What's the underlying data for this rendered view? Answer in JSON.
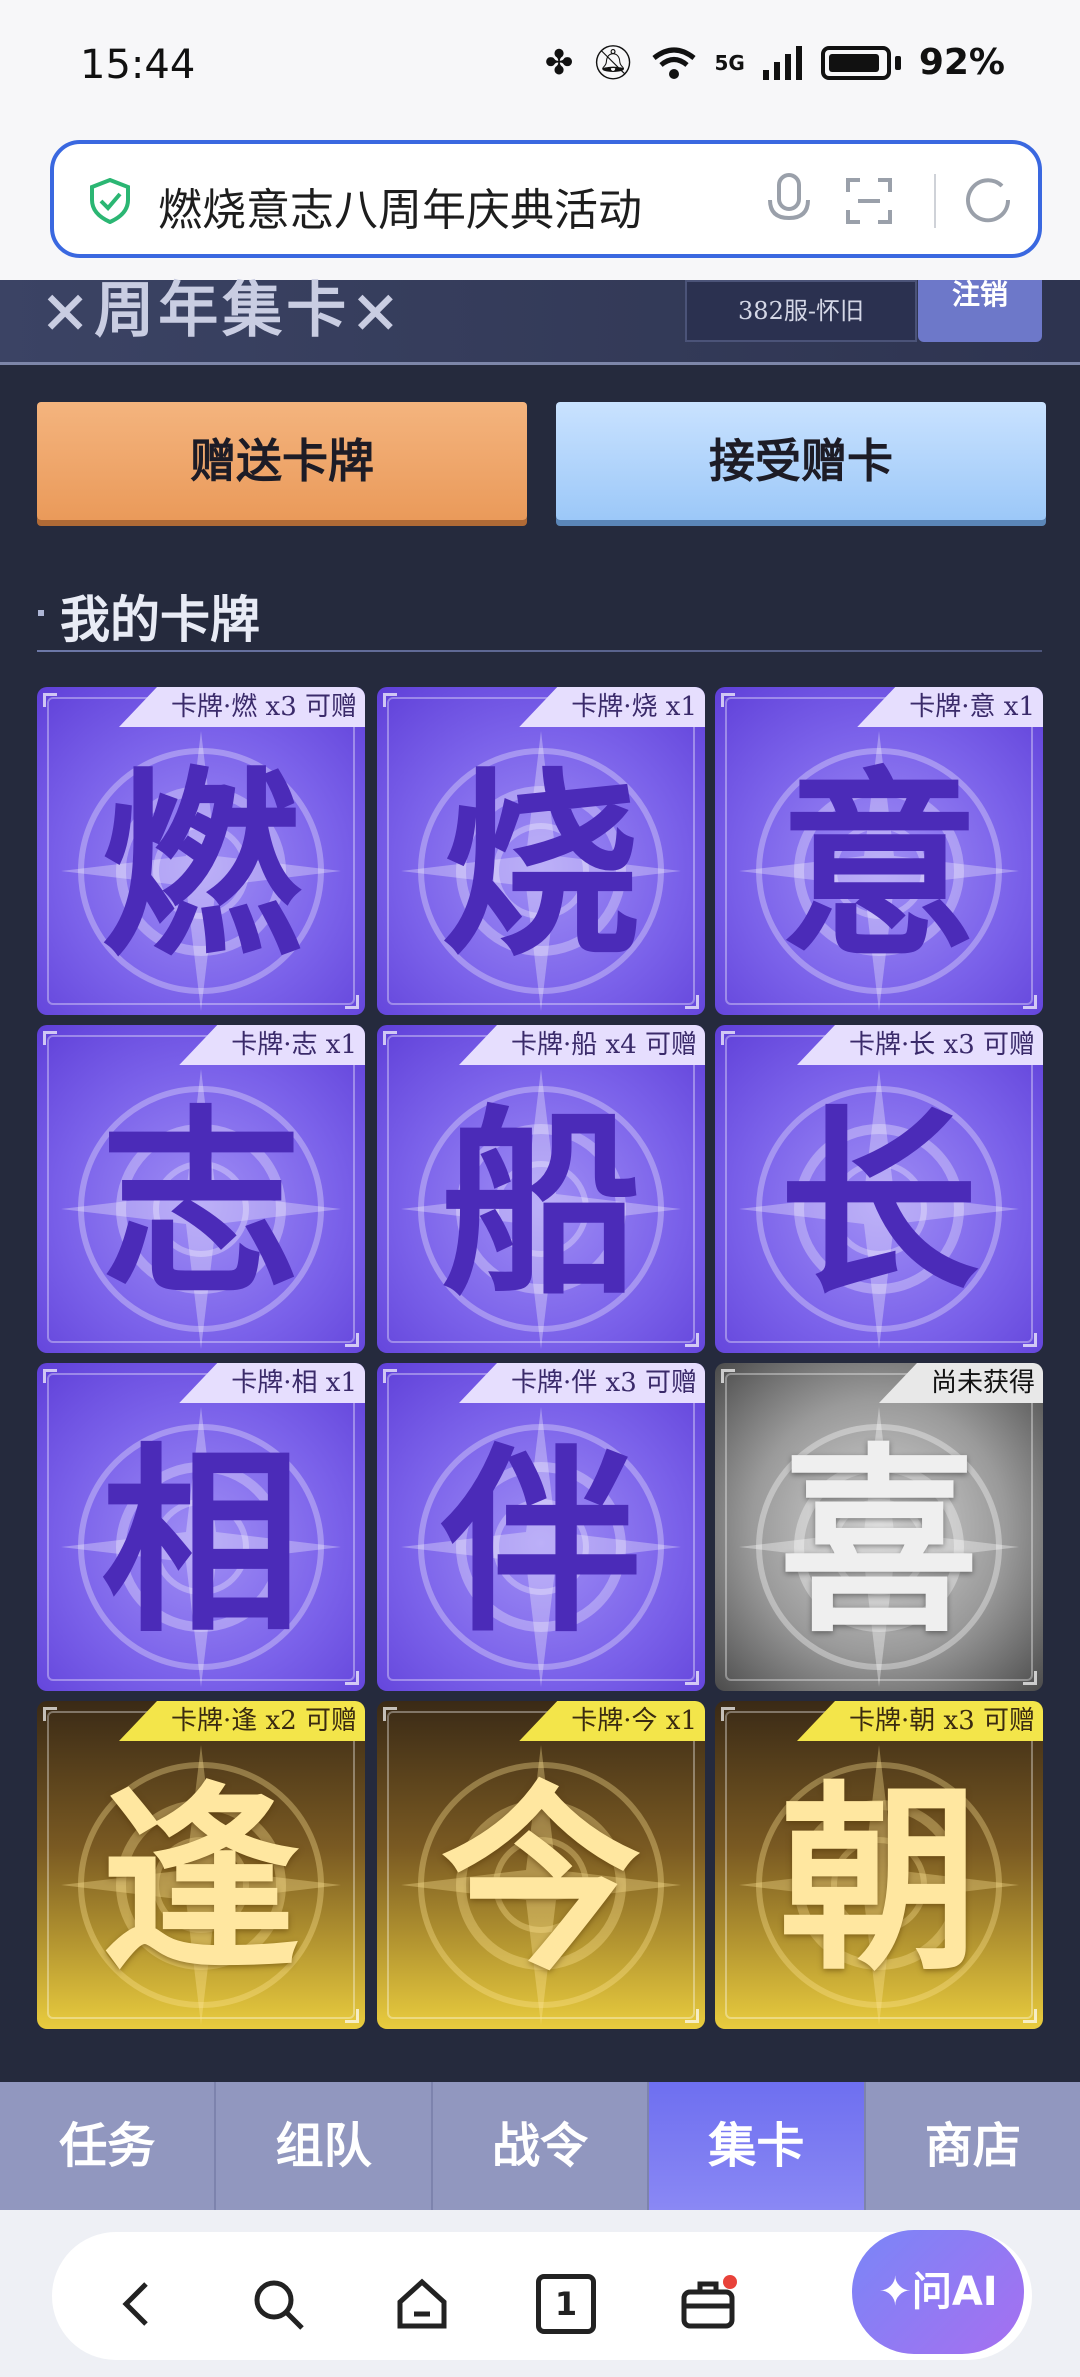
{
  "status_bar": {
    "time": "15:44",
    "network": "5G",
    "battery": "92%"
  },
  "browser": {
    "url_title": "燃烧意志八周年庆典活动"
  },
  "game_header": {
    "title": "×周年集卡×",
    "server": "382服-怀旧",
    "logout_label": "注销"
  },
  "actions": {
    "send_label": "赠送卡牌",
    "receive_label": "接受赠卡"
  },
  "section": {
    "title": "我的卡牌"
  },
  "cards": [
    {
      "char": "燃",
      "tag": "卡牌·燃 x3 可赠",
      "style": "purple"
    },
    {
      "char": "烧",
      "tag": "卡牌·烧 x1",
      "style": "purple"
    },
    {
      "char": "意",
      "tag": "卡牌·意 x1",
      "style": "purple"
    },
    {
      "char": "志",
      "tag": "卡牌·志 x1",
      "style": "purple"
    },
    {
      "char": "船",
      "tag": "卡牌·船 x4 可赠",
      "style": "purple"
    },
    {
      "char": "长",
      "tag": "卡牌·长 x3 可赠",
      "style": "purple"
    },
    {
      "char": "相",
      "tag": "卡牌·相 x1",
      "style": "purple"
    },
    {
      "char": "伴",
      "tag": "卡牌·伴 x3 可赠",
      "style": "purple"
    },
    {
      "char": "喜",
      "tag": "尚未获得",
      "style": "gray"
    },
    {
      "char": "逢",
      "tag": "卡牌·逢 x2 可赠",
      "style": "gold"
    },
    {
      "char": "今",
      "tag": "卡牌·今 x1",
      "style": "gold"
    },
    {
      "char": "朝",
      "tag": "卡牌·朝 x3 可赠",
      "style": "gold"
    }
  ],
  "tabs": [
    {
      "label": "任务",
      "active": false
    },
    {
      "label": "组队",
      "active": false
    },
    {
      "label": "战令",
      "active": false
    },
    {
      "label": "集卡",
      "active": true
    },
    {
      "label": "商店",
      "active": false
    }
  ],
  "browser_nav": {
    "tab_count": "1",
    "ai_label": "问AI"
  },
  "colors": {
    "accent": "#3a68e0",
    "purple_card": "#7b62ea",
    "gold_card": "#e9cc3e",
    "active_tab": "#6e6ff0"
  }
}
